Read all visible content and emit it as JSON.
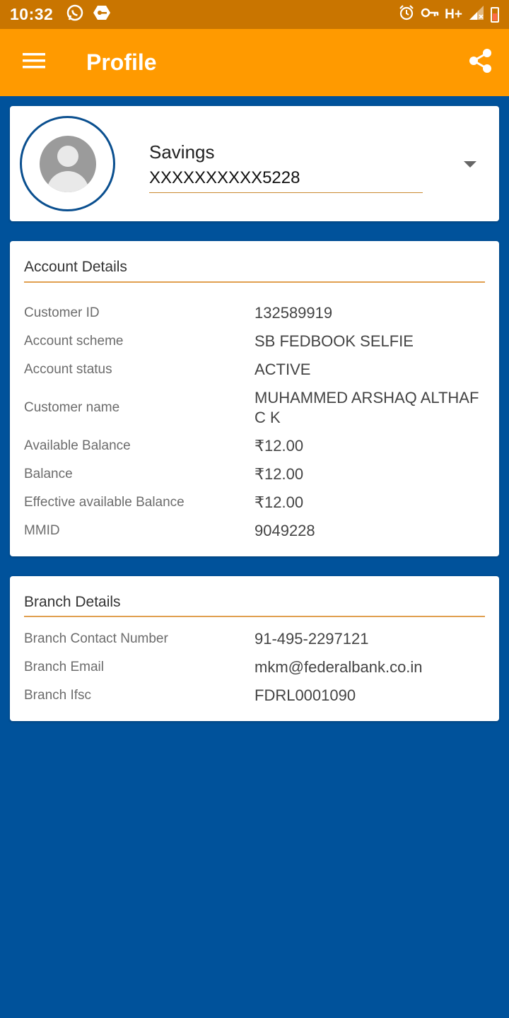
{
  "status_bar": {
    "time": "10:32",
    "network": "H+",
    "icons": [
      "whatsapp-icon",
      "vpn-key-icon",
      "alarm-icon",
      "key-icon",
      "signal-icon",
      "battery-icon"
    ]
  },
  "app_bar": {
    "title": "Profile",
    "menu_icon": "hamburger-menu-icon",
    "share_icon": "share-icon",
    "color": "#ff9a00"
  },
  "account": {
    "type": "Savings",
    "number": "XXXXXXXXXX5228"
  },
  "account_details": {
    "title": "Account Details",
    "rows": [
      {
        "label": "Customer ID",
        "value": "132589919"
      },
      {
        "label": "Account scheme",
        "value": "SB FEDBOOK SELFIE"
      },
      {
        "label": "Account status",
        "value": "ACTIVE"
      },
      {
        "label": "Customer name",
        "value": "MUHAMMED ARSHAQ ALTHAF C K"
      },
      {
        "label": "Available Balance",
        "value": "₹12.00"
      },
      {
        "label": "Balance",
        "value": "₹12.00"
      },
      {
        "label": "Effective available Balance",
        "value": "₹12.00"
      },
      {
        "label": "MMID",
        "value": "9049228"
      }
    ]
  },
  "branch_details": {
    "title": "Branch Details",
    "rows": [
      {
        "label": "Branch Contact Number",
        "value": "91-495-2297121"
      },
      {
        "label": "Branch Email",
        "value": "mkm@federalbank.co.in"
      },
      {
        "label": "Branch Ifsc",
        "value": "FDRL0001090"
      }
    ]
  },
  "colors": {
    "background": "#00529b",
    "status_bar": "#c97500",
    "accent_line": "#e0a050"
  }
}
